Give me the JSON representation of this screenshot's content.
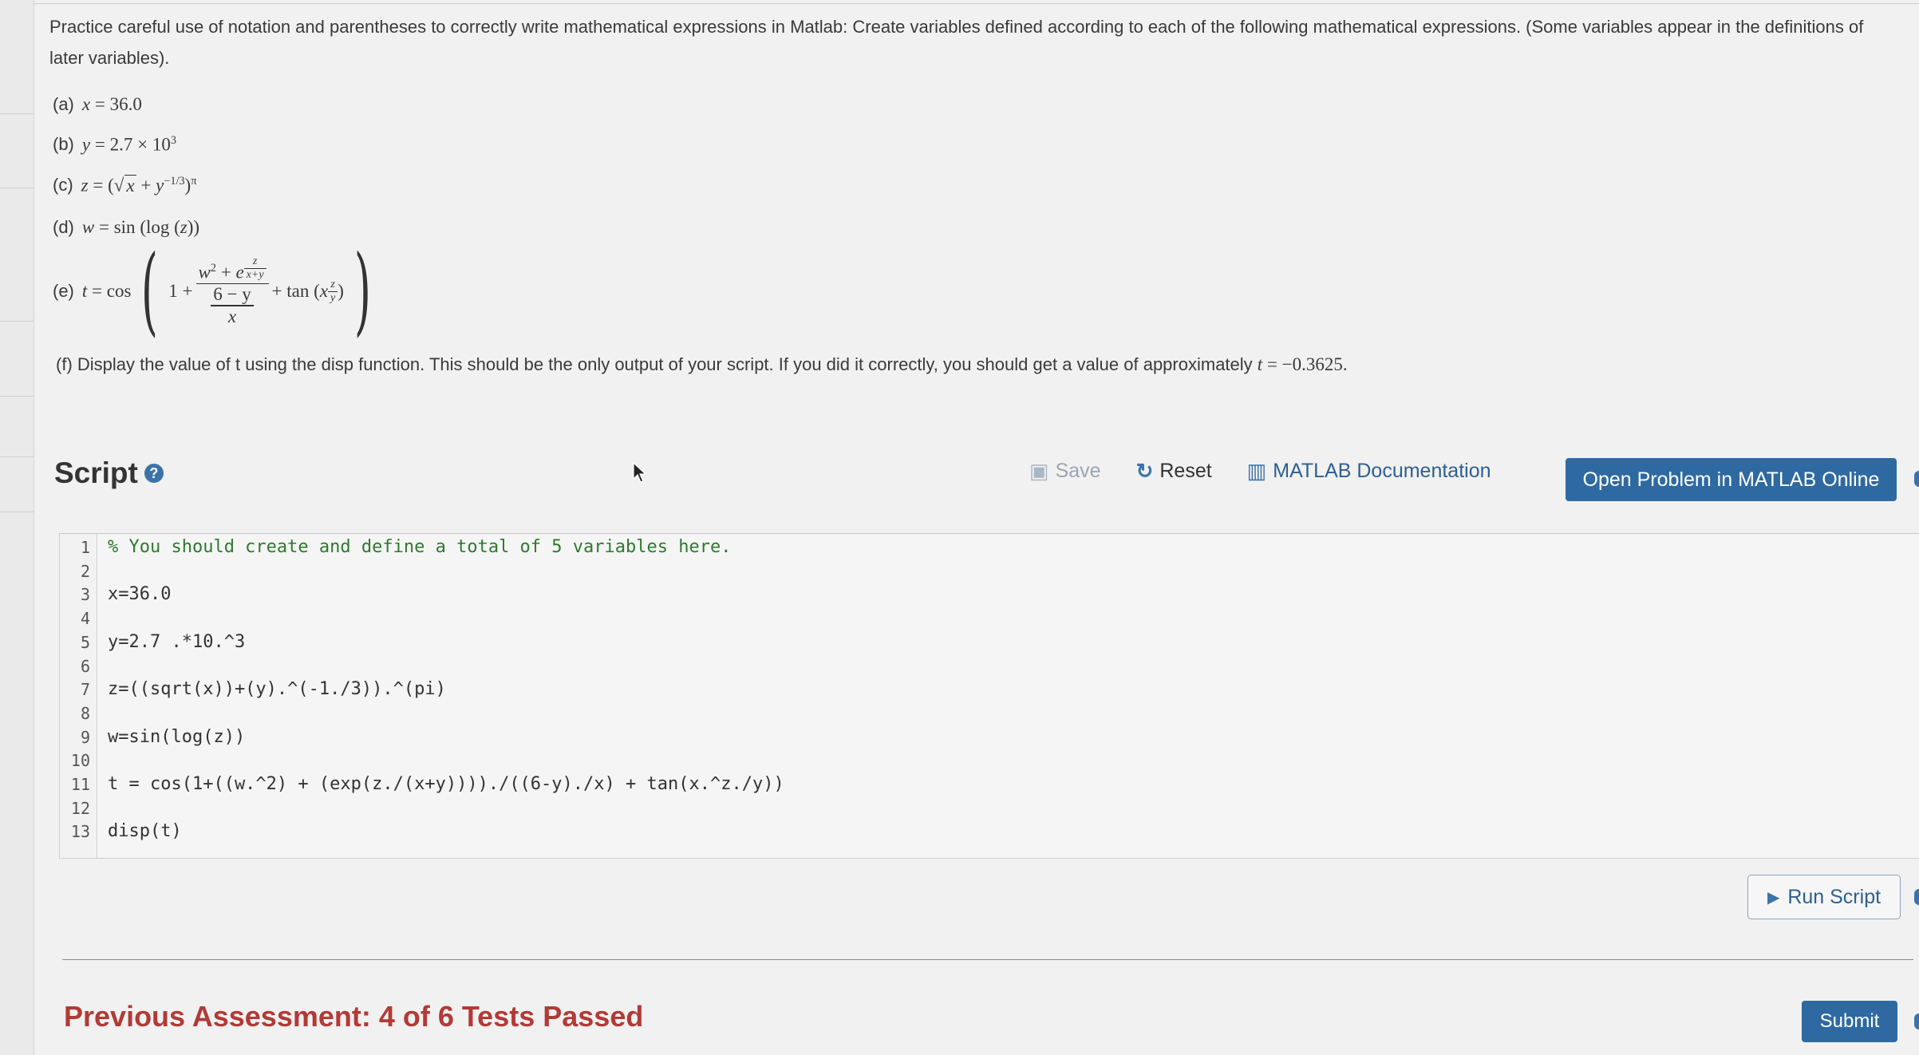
{
  "intro": "Practice careful use of notation and parentheses to correctly write mathematical expressions in Matlab: Create variables defined according to each of the following mathematical expressions. (Some variables appear in the definitions of later variables).",
  "parts": {
    "a": {
      "label": "(a)",
      "var": "x",
      "value": "36.0"
    },
    "b": {
      "label": "(b)",
      "var": "y",
      "mantissa": "2.7",
      "base": "10",
      "exponent": "3"
    },
    "c": {
      "label": "(c)",
      "var": "z",
      "x": "x",
      "y": "y",
      "inner_exp": "−1/3",
      "outer_exp": "π"
    },
    "d": {
      "label": "(d)",
      "var": "w",
      "fn1": "sin",
      "fn2": "log",
      "arg": "z"
    },
    "e": {
      "label": "(e)",
      "var": "t",
      "cos": "cos",
      "one": "1",
      "w": "w",
      "two": "2",
      "e": "e",
      "z": "z",
      "xy": "x+y",
      "six_minus_y": "6 − y",
      "x": "x",
      "tan": "tan",
      "y": "y"
    }
  },
  "part_f": {
    "text": "(f) Display the value of t using the disp function. This should be the only output of your script. If you did it correctly, you should get a value of approximately",
    "result_var": "t",
    "result_value": "−0.3625."
  },
  "script": {
    "title": "Script",
    "help_glyph": "?",
    "toolbar": {
      "save": "Save",
      "reset": "Reset",
      "docs": "MATLAB Documentation",
      "open": "Open Problem in MATLAB Online"
    },
    "lines": [
      "% You should create and define a total of 5 variables here.",
      "",
      "x=36.0",
      "",
      "y=2.7 .*10.^3",
      "",
      "z=((sqrt(x))+(y).^(-1./3)).^(pi)",
      "",
      "w=sin(log(z))",
      "",
      "t = cos(1+((w.^2) + (exp(z./(x+y))))./((6-y)./x) + tan(x.^z./y))",
      "",
      "disp(t)"
    ],
    "line_numbers": [
      "1",
      "2",
      "3",
      "4",
      "5",
      "6",
      "7",
      "8",
      "9",
      "10",
      "11",
      "12",
      "13"
    ],
    "run_label": "Run Script"
  },
  "assessment": "Previous Assessment: 4 of 6 Tests Passed",
  "submit_label": "Submit",
  "colors": {
    "primary": "#2e6aa1",
    "assessment_red": "#b23a36",
    "comment_green": "#2d7a2d"
  }
}
